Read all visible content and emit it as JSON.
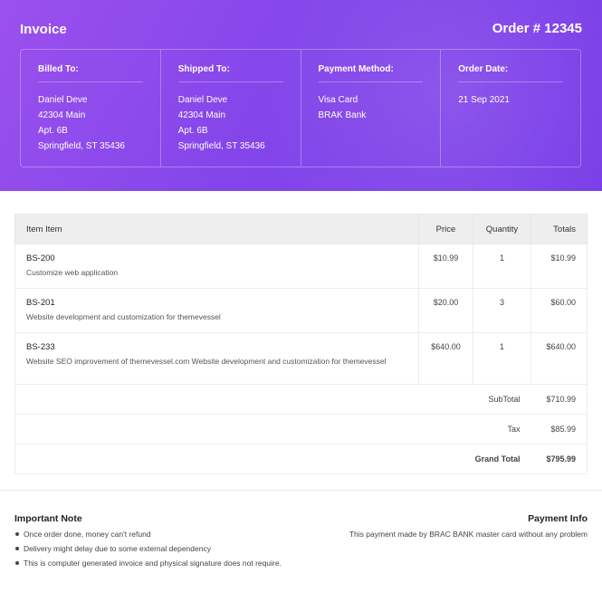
{
  "header": {
    "title": "Invoice",
    "order": "Order # 12345",
    "background_color": "#8446ea"
  },
  "info": {
    "billed_to": {
      "heading": "Billed To:",
      "lines": [
        "Daniel Deve",
        "42304 Main",
        "Apt. 6B",
        "Springfield, ST 35436"
      ]
    },
    "shipped_to": {
      "heading": "Shipped To:",
      "lines": [
        "Daniel Deve",
        "42304 Main",
        "Apt. 6B",
        "Springfield, ST 35436"
      ]
    },
    "payment_method": {
      "heading": "Payment Method:",
      "lines": [
        "Visa Card",
        "BRAK Bank"
      ]
    },
    "order_date": {
      "heading": "Order Date:",
      "lines": [
        "21 Sep 2021"
      ]
    }
  },
  "table": {
    "headers": {
      "item": "Item Item",
      "price": "Price",
      "quantity": "Quantity",
      "totals": "Totals"
    },
    "rows": [
      {
        "sku": "BS-200",
        "desc": "Customize web application",
        "price": "$10.99",
        "qty": "1",
        "total": "$10.99"
      },
      {
        "sku": "BS-201",
        "desc": "Website development and customization for themevessel",
        "price": "$20.00",
        "qty": "3",
        "total": "$60.00"
      },
      {
        "sku": "BS-233",
        "desc": "Website SEO improvement of themevessel.com Website development and customization for themevessel",
        "price": "$640.00",
        "qty": "1",
        "total": "$640.00"
      }
    ],
    "subtotal": {
      "label": "SubTotal",
      "value": "$710.99"
    },
    "tax": {
      "label": "Tax",
      "value": "$85.99"
    },
    "grand_total": {
      "label": "Grand Total",
      "value": "$795.99"
    }
  },
  "note": {
    "heading": "Important Note",
    "items": [
      "Once order done, money can't refund",
      "Delivery might delay due to some external dependency",
      "This is computer generated invoice and physical signature does not require."
    ]
  },
  "payment_info": {
    "heading": "Payment Info",
    "text": "This payment made by BRAC BANK master card without any problem"
  }
}
